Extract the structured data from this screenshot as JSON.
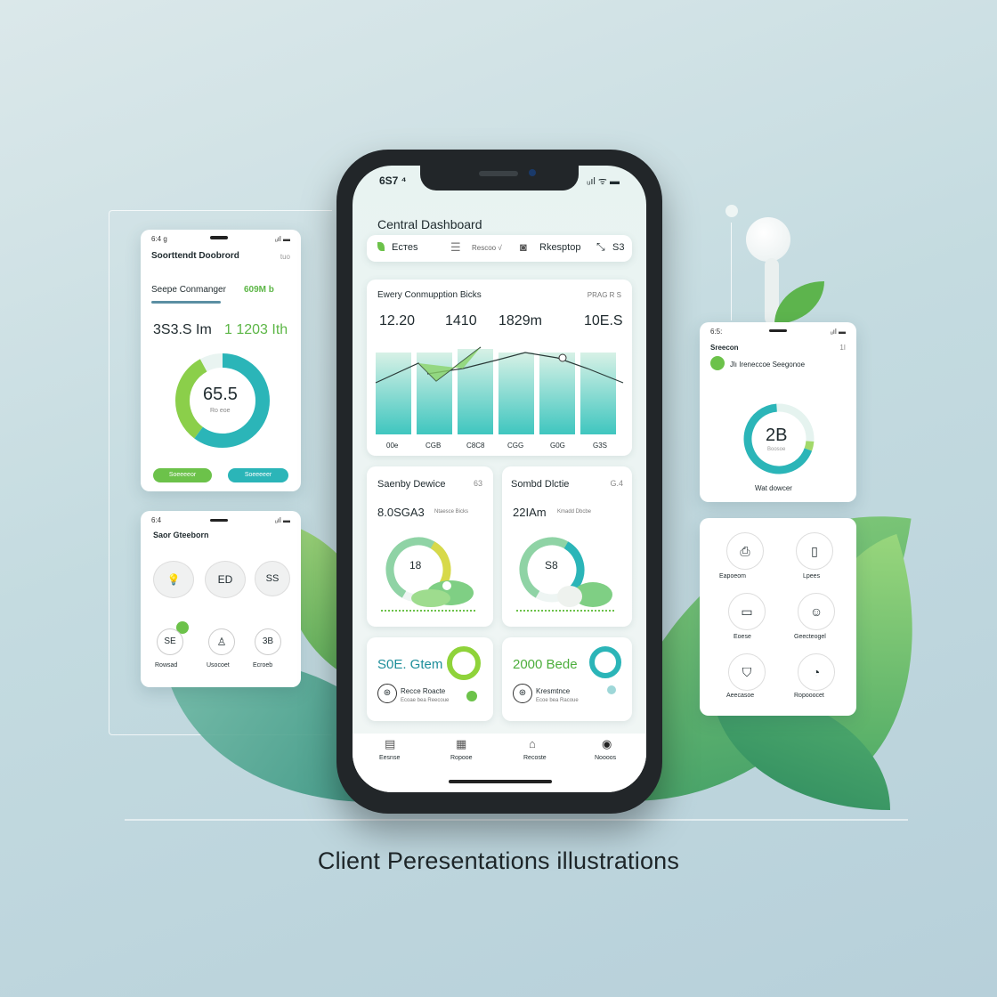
{
  "caption": "Client Peresentations illustrations",
  "phone": {
    "status_time": "6S7 ⁴",
    "status_right": "ᵤıl ᯤ ▬",
    "title": "Central Dashboard",
    "tabs": [
      {
        "label": "Eстes",
        "icon": "leaf-icon"
      },
      {
        "label": "Rеѕсοо √",
        "icon": "list-icon"
      },
      {
        "label": "Rkesptop",
        "icon": "device-icon"
      },
      {
        "label": "S3",
        "icon": "expand-icon"
      }
    ],
    "energy": {
      "title": "Ewery Conmupption Bicks",
      "tag": "PRAG R S",
      "readings": [
        "12.20",
        "1410",
        "1829m",
        "10E.S"
      ],
      "xticks": [
        "00e",
        "CGB",
        "C8C8",
        "CGG",
        "G0G",
        "G3S"
      ]
    },
    "device1": {
      "title": "Saenby Dewice",
      "tag": "63",
      "value": "8.0SGA3",
      "sub": "Ntaesce Bicks",
      "center": "18"
    },
    "device2": {
      "title": "Sombd Dlctie",
      "tag": "G.4",
      "value": "22IAm",
      "sub": "Kmadd Dbcbe",
      "center": "S8"
    },
    "card3": {
      "value": "S0E. Gtem",
      "label": "Recce Roacte",
      "sub": "Ecoae bea Reecoue"
    },
    "card4": {
      "value": "2000 Bede",
      "label": "Kresmtnce",
      "sub": "Ecoe bea Racoue"
    },
    "nav": [
      "Eesnse",
      "Ropooe",
      "Recoste",
      "Noooos"
    ]
  },
  "left1": {
    "status": "6:4 g",
    "status_right": "ᵤıl ▬",
    "title": "Soorttendt Doobrord",
    "tag": "tuo",
    "sub": "Seepe Conmanger",
    "sub_value": "609M b",
    "value1": "3S3.S Im",
    "value2": "1  1203 Ith",
    "donut_value": "65.5",
    "donut_sub": "Ro eoe",
    "btn1": "Soeeeeor",
    "btn2": "Soeeeeer"
  },
  "left2": {
    "status": "6:4",
    "status_right": "ᵤıl ▬",
    "title": "Saor Gteeborn",
    "icons": [
      {
        "label": "",
        "icon": "bulb-icon",
        "text": ""
      },
      {
        "label": "",
        "icon": "plug-icon",
        "text": "ED"
      },
      {
        "label": "",
        "icon": "socket-icon",
        "text": "SS"
      },
      {
        "label": "Rowsad",
        "icon": "speaker-icon",
        "text": "SE"
      },
      {
        "label": "Usocoet",
        "icon": "lamp-icon",
        "text": ""
      },
      {
        "label": "Ecroeb",
        "icon": "fridge-icon",
        "text": "3B"
      }
    ]
  },
  "right1": {
    "status": "6:5:",
    "status_right": "ᵤıl ▬",
    "title": "Sreecon",
    "tag": "1I",
    "row": "Jlı Ireneccoe Seegonoe",
    "donut_value": "2B",
    "donut_sub": "Boosoe",
    "footer": "Wat dowcer"
  },
  "right2": {
    "icons": [
      {
        "label": "Eapoeom",
        "icon": "printer-icon"
      },
      {
        "label": "Lpees",
        "icon": "door-icon"
      },
      {
        "label": "Eoese",
        "icon": "display-icon"
      },
      {
        "label": "Geecteogel",
        "icon": "robot-icon"
      },
      {
        "label": "Aeecasoe",
        "icon": "shield-icon"
      },
      {
        "label": "Ropooocet",
        "icon": "clock-icon"
      }
    ]
  },
  "colors": {
    "green": "#6cc24a",
    "teal": "#2bb5b8",
    "mint": "#a8e3d3",
    "leaf": "#3f9c6a"
  }
}
